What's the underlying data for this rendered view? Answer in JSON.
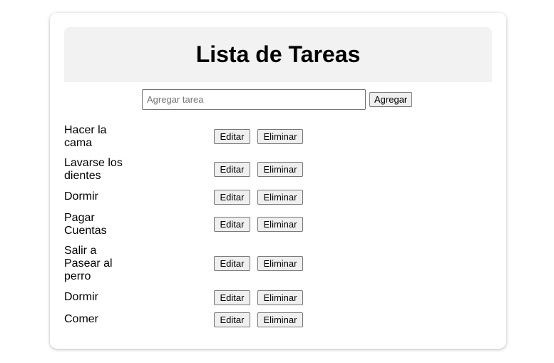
{
  "header": {
    "title": "Lista de Tareas"
  },
  "add_form": {
    "input_value": "",
    "input_placeholder": "Agregar tarea",
    "add_label": "Agregar"
  },
  "actions": {
    "edit_label": "Editar",
    "delete_label": "Eliminar"
  },
  "tasks": [
    {
      "text": "Hacer la cama"
    },
    {
      "text": "Lavarse los dientes"
    },
    {
      "text": "Dormir"
    },
    {
      "text": "Pagar Cuentas"
    },
    {
      "text": "Salir a Pasear al perro"
    },
    {
      "text": "Dormir"
    },
    {
      "text": "Comer"
    }
  ]
}
